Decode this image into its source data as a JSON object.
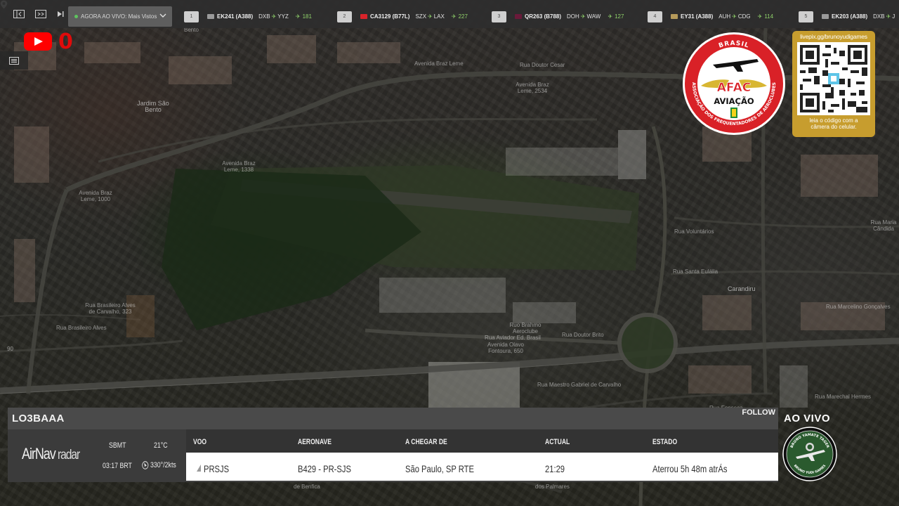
{
  "topbar": {
    "live_label": "AGORA AO VIVO: Mais Vistos",
    "flights": [
      {
        "num": "1",
        "code": "EK241 (A388)",
        "from": "DXB",
        "to": "YYZ",
        "count": "181",
        "logo_color": "#9a9a9a"
      },
      {
        "num": "2",
        "code": "CA3129 (B77L)",
        "from": "SZX",
        "to": "LAX",
        "count": "227",
        "logo_color": "#d8232a"
      },
      {
        "num": "3",
        "code": "QR263 (B788)",
        "from": "DOH",
        "to": "WAW",
        "count": "127",
        "logo_color": "#6a1a3a"
      },
      {
        "num": "4",
        "code": "EY31 (A388)",
        "from": "AUH",
        "to": "CDG",
        "count": "114",
        "logo_color": "#b59a5a"
      },
      {
        "num": "5",
        "code": "EK203 (A388)",
        "from": "DXB",
        "to": "J",
        "count": "",
        "logo_color": "#9a9a9a"
      }
    ]
  },
  "youtube": {
    "count": "0"
  },
  "map": {
    "labels": [
      {
        "text": "Bento"
      },
      {
        "text": "Jardim São\nBento"
      },
      {
        "text": "Avenida Braz\nLeme, 1338"
      },
      {
        "text": "Avenida Braz\nLeme, 1000"
      },
      {
        "text": "Avenida Braz Leme"
      },
      {
        "text": "Rua Doutor Cesar"
      },
      {
        "text": "Avenida Braz\nLeme, 2534"
      },
      {
        "text": "Rua Brasileiro Alves\nde Carvalho, 323"
      },
      {
        "text": "Rua Brasileiro Alves"
      },
      {
        "text": "Rua Aviador Ed. Brasil"
      },
      {
        "text": "Rua Doutor Brito"
      },
      {
        "text": "Avenida Olavo\nFontoura, 650"
      },
      {
        "text": "Ruo Brahmo\nAeroclube"
      },
      {
        "text": "Rua Santa Eulália"
      },
      {
        "text": "Rua Voluntários"
      },
      {
        "text": "Carandiru"
      },
      {
        "text": "Rua Marcelino Gonçalves"
      },
      {
        "text": "Rua Maria Cândida"
      },
      {
        "text": "Rua Marechal Hermes"
      },
      {
        "text": "Rua Maestro Gabriel de Carvalho"
      },
      {
        "text": "dos Palmares"
      },
      {
        "text": "de Benfica"
      },
      {
        "text": "Rua Fonseca"
      },
      {
        "text": "90"
      }
    ]
  },
  "afac": {
    "brand": "AFAC",
    "subtitle": "AVIAÇÃO",
    "top_text": "BRASIL",
    "ring_left": "AFAC",
    "ring_right": "AVIAÇÃO",
    "ring_bottom": "ASSOCIAÇÃO DOS FREQUENTADORES DE AEROCLUBES"
  },
  "qr": {
    "url": "livepix.gg/brunoyudigames",
    "caption": "leia o código com a\ncâmera do celular."
  },
  "panel": {
    "registration": "LO3BAAA",
    "follow_label": "FOLLOW",
    "brand": "AirNav",
    "brand_suffix": "radar",
    "airport_code": "SBMT",
    "temperature": "21°C",
    "local_time": "03:17 BRT",
    "wind": "330°/2kts",
    "columns": [
      "VOO",
      "AERONAVE",
      "A CHEGAR DE",
      "ACTUAL",
      "ESTADO"
    ],
    "row": {
      "flight": "PRSJS",
      "aircraft": "B429 - PR-SJS",
      "origin": "São Paulo, SP RTE",
      "actual": "21:29",
      "status": "Aterrou 5h 48m atrÁs"
    }
  },
  "live_badge": {
    "label": "AO VIVO",
    "channel_top": "BRUNO YAMATE TAGER",
    "channel_bottom": "BRUNO YUDI GAMES"
  }
}
